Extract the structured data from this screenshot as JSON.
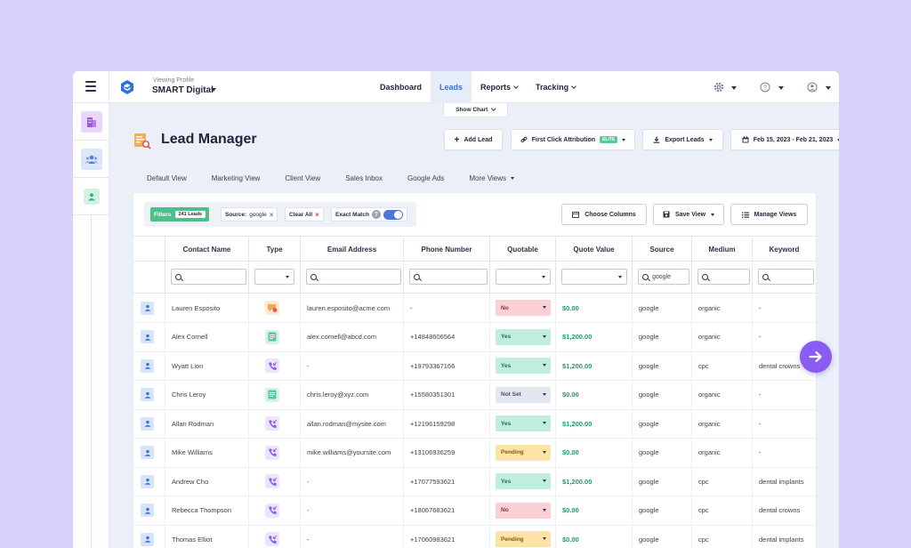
{
  "header": {
    "profile_caption": "Viewing Profile",
    "profile_name": "SMART Digital",
    "nav": [
      {
        "label": "Dashboard"
      },
      {
        "label": "Leads"
      },
      {
        "label": "Reports"
      },
      {
        "label": "Tracking"
      }
    ]
  },
  "main": {
    "show_chart": "Show Chart",
    "title": "Lead Manager",
    "buttons": {
      "add_lead": "Add Lead",
      "attribution": "First Click Attribution",
      "attribution_badge": "ELITE",
      "export": "Export Leads",
      "date_range": "Feb 15, 2023 - Feb 21, 2023"
    },
    "views": [
      "Default View",
      "Marketing View",
      "Client View",
      "Sales Inbox",
      "Google Ads",
      "More Views"
    ],
    "filters": {
      "label": "Filters",
      "count": "241 Leads",
      "source_key": "Source:",
      "source_val": "google",
      "clear_all": "Clear All",
      "exact_match": "Exact Match"
    },
    "actions": {
      "choose_columns": "Choose Columns",
      "save_view": "Save View",
      "manage_views": "Manage Views"
    }
  },
  "table": {
    "headers": [
      "Contact Name",
      "Type",
      "Email Address",
      "Phone Number",
      "Quotable",
      "Quote Value",
      "Source",
      "Medium",
      "Keyword"
    ],
    "source_filter_value": "google",
    "rows": [
      {
        "name": "Lauren Esposito",
        "type": "chat",
        "email": "lauren.esposito@acme.com",
        "phone": "-",
        "quotable": "No",
        "quote": "$0.00",
        "source": "google",
        "medium": "organic",
        "keyword": "-"
      },
      {
        "name": "Alex Cornell",
        "type": "form",
        "email": "alex.cornell@abcd.com",
        "phone": "+14848606564",
        "quotable": "Yes",
        "quote": "$1,200.00",
        "source": "google",
        "medium": "organic",
        "keyword": "-"
      },
      {
        "name": "Wyatt Lion",
        "type": "call",
        "email": "-",
        "phone": "+19793367166",
        "quotable": "Yes",
        "quote": "$1,200.00",
        "source": "google",
        "medium": "cpc",
        "keyword": "dental crowns"
      },
      {
        "name": "Chris Leroy",
        "type": "form",
        "email": "chris.leroy@xyz.com",
        "phone": "+15580351301",
        "quotable": "Not Set",
        "quote": "$0.00",
        "source": "google",
        "medium": "organic",
        "keyword": "-"
      },
      {
        "name": "Allan Rodman",
        "type": "call",
        "email": "allan.rodman@mysite.com",
        "phone": "+12196159298",
        "quotable": "Yes",
        "quote": "$1,200.00",
        "source": "google",
        "medium": "organic",
        "keyword": "-"
      },
      {
        "name": "Mike Williams",
        "type": "call",
        "email": "mike.williams@yoursite.com",
        "phone": "+13106936259",
        "quotable": "Pending",
        "quote": "$0.00",
        "source": "google",
        "medium": "organic",
        "keyword": "-"
      },
      {
        "name": "Andrew Cho",
        "type": "call",
        "email": "-",
        "phone": "+17077593621",
        "quotable": "Yes",
        "quote": "$1,200.00",
        "source": "google",
        "medium": "cpc",
        "keyword": "dental implants"
      },
      {
        "name": "Rebecca Thompson",
        "type": "call",
        "email": "-",
        "phone": "+18067683621",
        "quotable": "No",
        "quote": "$0.00",
        "source": "google",
        "medium": "cpc",
        "keyword": "dental crowns"
      },
      {
        "name": "Thomas Elliot",
        "type": "call",
        "email": "-",
        "phone": "+17060983621",
        "quotable": "Pending",
        "quote": "$0.00",
        "source": "google",
        "medium": "cpc",
        "keyword": "dental implants"
      }
    ]
  },
  "colors": {
    "accent": "#3f6fd1",
    "green": "#4cbf8a",
    "fab": "#8a5cf2"
  }
}
